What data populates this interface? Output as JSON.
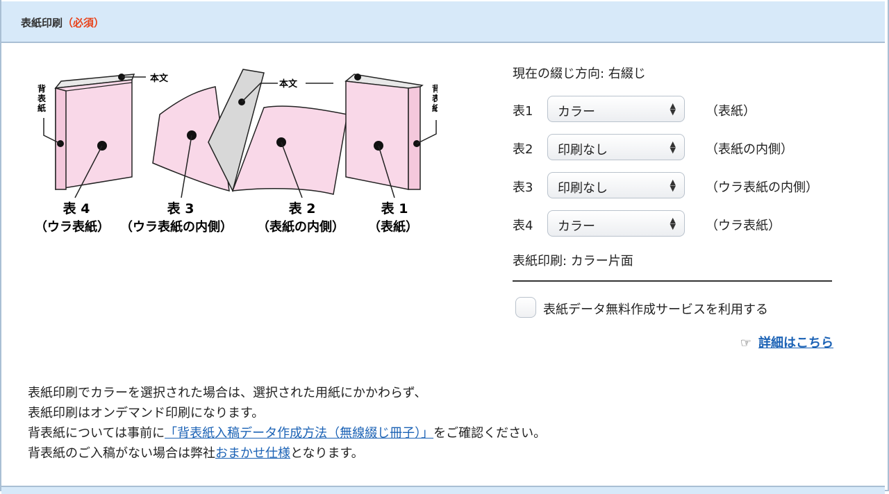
{
  "header": {
    "title": "表紙印刷",
    "required": "（必須）"
  },
  "diagram": {
    "callouts": {
      "honbun_left": "本文",
      "honbun_mid": "本文",
      "sebyoushi_left": "背表紙",
      "sebyoushi_right": "背表紙"
    },
    "captions": [
      {
        "number": "表 4",
        "desc": "（ウラ表紙）"
      },
      {
        "number": "表 3",
        "desc": "（ウラ表紙の内側）"
      },
      {
        "number": "表 2",
        "desc": "（表紙の内側）"
      },
      {
        "number": "表 1",
        "desc": "（表紙）"
      }
    ],
    "colors": {
      "page": "#f9d8e8",
      "outline": "#222222",
      "paper": "#dcdcdc"
    }
  },
  "settings": {
    "direction": "現在の綴じ方向: 右綴じ",
    "rows": [
      {
        "label": "表1",
        "value": "カラー",
        "desc": "（表紙）"
      },
      {
        "label": "表2",
        "value": "印刷なし",
        "desc": "（表紙の内側）"
      },
      {
        "label": "表3",
        "value": "印刷なし",
        "desc": "（ウラ表紙の内側）"
      },
      {
        "label": "表4",
        "value": "カラー",
        "desc": "（ウラ表紙）"
      }
    ],
    "summary": "表紙印刷: カラー片面",
    "service_checkbox": {
      "label": "表紙データ無料作成サービスを利用する",
      "checked": false
    },
    "details_link": "詳細はこちら",
    "hand_icon": "pointing-hand-icon"
  },
  "notes": {
    "line1": "表紙印刷でカラーを選択された場合は、選択された用紙にかかわらず、",
    "line2": "表紙印刷はオンデマンド印刷になります。",
    "line3_prefix": "背表紙については事前に",
    "line3_link": "「背表紙入稿データ作成方法（無線綴じ冊子）」",
    "line3_suffix": "をご確認ください。",
    "line4_prefix": "背表紙のご入稿がない場合は弊社",
    "line4_link": "おまかせ仕様",
    "line4_suffix": "となります。"
  },
  "colors": {
    "header_bg": "#d7e9f9",
    "border": "#a9bfd4",
    "required": "#e8431b",
    "link": "#1b62b5"
  }
}
